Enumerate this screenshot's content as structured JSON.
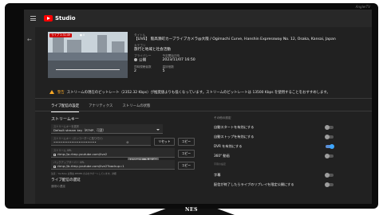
{
  "app": {
    "name": "Studio",
    "corner_text": "AnglerTV"
  },
  "stand": {
    "brand": "NES"
  },
  "preview": {
    "live_badge": "ライブ 2:31:49",
    "stats": "● 0"
  },
  "meta": {
    "title_label": "タイトル",
    "title": "【LIVE】 阪高湊町カーブライブカメラ@大阪 / Ogimachi Curve, Hanshin Expressway No. 12, Osaka, Kansai, Japan",
    "category_label": "カテゴリ",
    "category": "旅行と地域と社会活動",
    "privacy_label": "プライバシー",
    "privacy": "公開",
    "scheduled_label": "予定開始日時",
    "scheduled": "2023/11/07 16:50",
    "viewers_label": "同時視聴者数",
    "viewers": "2",
    "likes_label": "高評価数",
    "likes": "5"
  },
  "warning": {
    "prefix": "警告",
    "text": "ストリームの現在のビットレート（2352.32 Kbps）が推奨値よりも低くなっています。ストリームのビットレートは 13500 Kbps を使用することをおすすめします。"
  },
  "tabs": [
    {
      "label": "ライブ配信の設定",
      "active": true
    },
    {
      "label": "アナリティクス",
      "active": false
    },
    {
      "label": "ストリームの状態",
      "active": false
    }
  ],
  "stream_key": {
    "section_title": "ストリームキー",
    "select_label": "ストリームキーを選択",
    "select_value": "Default stream key（RTMP、可変）",
    "key_label": "ストリームキー（エンコーダーに貼り付け）",
    "key_value": "••••••••••••••••••••••••",
    "reset_button": "リセット",
    "copy_button": "コピー",
    "url_label": "ストリーム URL",
    "url_value": "rtmp://a.rtmp.youtube.com/live2",
    "tooltip": "ストリーム URL をコピー",
    "backup_label": "バックアップサーバー URL",
    "backup_value": "rtmp://b.rtmp.youtube.com/live2?backup=1",
    "note": "注意：YouTube は現在 RTMPS のみをサポートしています。詳細",
    "latency_title": "ライブ配信の遅延",
    "latency_option": "通常の遅延"
  },
  "settings": {
    "title": "その他の設定",
    "items": [
      {
        "label": "自動スタートを有効にする",
        "on": false
      },
      {
        "label": "自動ストップを有効にする",
        "on": false
      },
      {
        "label": "DVR を有効にする",
        "on": true
      },
      {
        "label": "360° 動画",
        "on": false
      }
    ],
    "sub_note": "字幕の設定",
    "items2": [
      {
        "label": "字幕",
        "on": false
      },
      {
        "label": "配信が終了したらライブのリプレイを限定公開にする",
        "on": false
      }
    ]
  }
}
